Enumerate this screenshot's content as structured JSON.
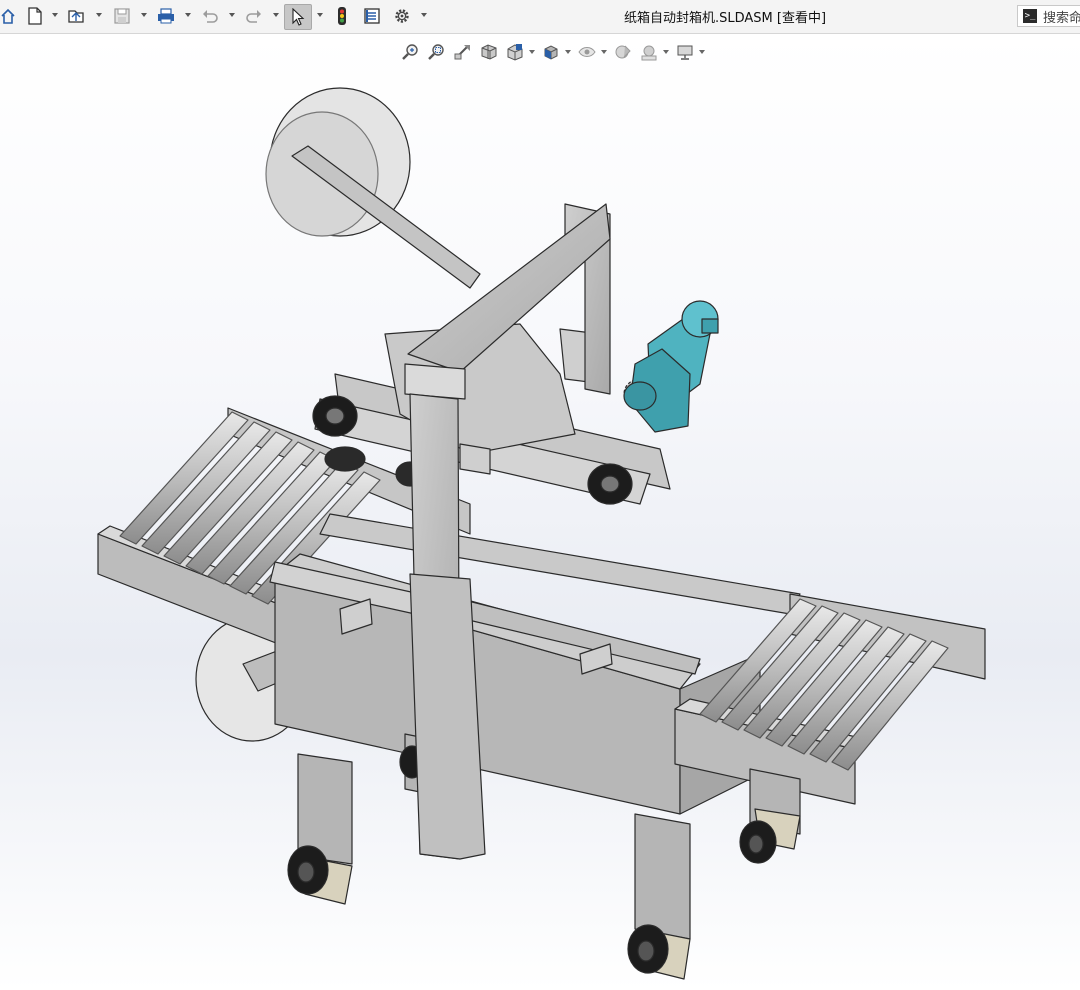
{
  "window": {
    "title": "纸箱自动封箱机.SLDASM [查看中]",
    "search_label": "搜索命"
  },
  "toolbar": {
    "items": [
      "home-icon",
      "new-document-icon",
      "open-document-icon",
      "save-icon",
      "print-icon",
      "undo-icon",
      "redo-icon",
      "select-pointer-icon",
      "rebuild-traffic-light-icon",
      "file-properties-icon",
      "options-gear-icon"
    ]
  },
  "heads_up_toolbar": {
    "items": [
      "zoom-to-fit-icon",
      "zoom-to-area-icon",
      "previous-view-icon",
      "section-view-icon",
      "view-orientation-icon",
      "display-style-icon",
      "hide-show-items-icon",
      "edit-appearance-icon",
      "apply-scene-icon",
      "view-settings-icon"
    ]
  },
  "colors": {
    "model_gray": "#bdbdbd",
    "motor_teal": "#4fb3c0",
    "caster_beige": "#d8d2bd",
    "wheel_black": "#1c1c1c"
  }
}
